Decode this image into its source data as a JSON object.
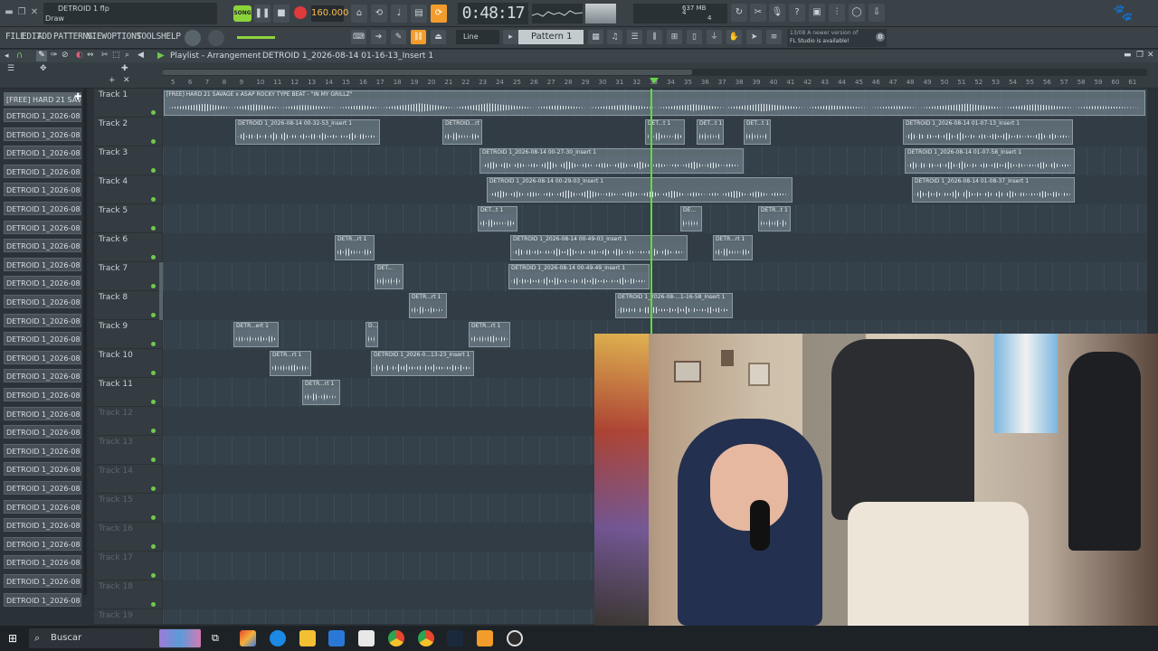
{
  "app": {
    "project_name": "DETROID 1 flp",
    "tool_label": "Draw",
    "song_mode": "SONG",
    "tempo": "160.000",
    "time": "0:48:17",
    "mem": "637 MB",
    "counter_a": "4",
    "counter_b": "4",
    "pattern": "Pattern 1",
    "snap": "Line",
    "update_notice_line1": "13/08  A newer version of",
    "update_notice_line2": "FL Studio is available!"
  },
  "menu": {
    "items": [
      "FILE",
      "EDIT",
      "ADD",
      "PATTERNS",
      "VIEW",
      "OPTIONS",
      "TOOLS",
      "HELP"
    ]
  },
  "playlist": {
    "title": "Playlist - Arrangement",
    "breadcrumb_sep": "›",
    "clip_path": "DETROID 1_2026-08-14 01-16-13_Insert 1",
    "ruler": [
      "5",
      "6",
      "7",
      "8",
      "9",
      "10",
      "11",
      "12",
      "13",
      "14",
      "15",
      "16",
      "17",
      "18",
      "19",
      "20",
      "21",
      "22",
      "23",
      "24",
      "25",
      "26",
      "27",
      "28",
      "29",
      "30",
      "31",
      "32",
      "33",
      "34",
      "35",
      "36",
      "37",
      "38",
      "39",
      "40",
      "41",
      "42",
      "43",
      "44",
      "45",
      "46",
      "47",
      "48",
      "49",
      "50",
      "51",
      "52",
      "53",
      "54",
      "55",
      "56",
      "57",
      "58",
      "59",
      "60",
      "61"
    ]
  },
  "browser": {
    "first_item": "[FREE] HARD 21 SAVA...",
    "items": [
      "DETROID 1_2026-08-14 0...",
      "DETROID 1_2026-08-14 0...",
      "DETROID 1_2026-08-14 0...",
      "DETROID 1_2026-08-14 0...",
      "DETROID 1_2026-08-14 0...",
      "DETROID 1_2026-08-14 0...",
      "DETROID 1_2026-08-14 0...",
      "DETROID 1_2026-08-14 0...",
      "DETROID 1_2026-08-14 0...",
      "DETROID 1_2026-08-14 0...",
      "DETROID 1_2026-08-14 0...",
      "DETROID 1_2026-08-14 0...",
      "DETROID 1_2026-08-14 0...",
      "DETROID 1_2026-08-14 0...",
      "DETROID 1_2026-08-14 0...",
      "DETROID 1_2026-08-14 0...",
      "DETROID 1_2026-08-14 0...",
      "DETROID 1_2026-08-14 0...",
      "DETROID 1_2026-08-14 0...",
      "DETROID 1_2026-08-14 0...",
      "DETROID 1_2026-08-14 0...",
      "DETROID 1_2026-08-14 0...",
      "DETROID 1_2026-08-14 0...",
      "DETROID 1_2026-08-14 0...",
      "DETROID 1_2026-08-14 0...",
      "DETROID 1_2026-08-14 0...",
      "DETROID 1_2026-08-14 0..."
    ]
  },
  "tracks": [
    "Track 1",
    "Track 2",
    "Track 3",
    "Track 4",
    "Track 5",
    "Track 6",
    "Track 7",
    "Track 8",
    "Track 9",
    "Track 10",
    "Track 11",
    "Track 12",
    "Track 13",
    "Track 14",
    "Track 15",
    "Track 16",
    "Track 17",
    "Track 18",
    "Track 19"
  ],
  "clips": {
    "t1": "[FREE] HARD 21 SAVAGE x ASAP ROCKY TYPE BEAT - \"IN MY GRILLZ\"",
    "t2a": "DETROID 1_2026-08-14 00-32-53_Insert 1",
    "t2b": "DETROID...rt 1",
    "t2c": "DET...t 1",
    "t2d": "DET...t 1",
    "t2e": "DET...t 1",
    "t2f": "DETROID 1_2026-08-14 01-07-13_Insert 1",
    "t3a": "DETROID 1_2026-08-14 00-27-30_Insert 1",
    "t3b": "DETROID 1_2026-08-14 01-07-58_Insert 1",
    "t4a": "DETROID 1_2026-08-14 00-29-03_Insert 1",
    "t4b": "DETROID 1_2026-08-14 01-08-37_Insert 1",
    "t5a": "DET...t 1",
    "t5b": "DE...",
    "t5c": "DETR...t 1",
    "t6a": "DETR...rt 1",
    "t6b": "DETROID 1_2026-08-14 00-49-03_Insert 1",
    "t6c": "DETR...rt 1",
    "t7a": "DET...",
    "t7b": "DETROID 1_2026-08-14 00-49-49_Insert 1",
    "t8a": "DETR...rt 1",
    "t8b": "DETROID 1_2026-08-...1-16-58_Insert 1",
    "t9a": "DETR...ert 1",
    "t9b": "D...",
    "t9c": "DETR...rt 1",
    "t10a": "DETR...rt 1",
    "t10b": "DETROID 1_2026-0...13-23_Insert 1",
    "t11a": "DETR...rt 1"
  },
  "taskbar": {
    "search_placeholder": "Buscar"
  },
  "colors": {
    "playhead": "#5fdc3d",
    "record": "#e0393e",
    "accent_orange": "#f29c2b"
  }
}
